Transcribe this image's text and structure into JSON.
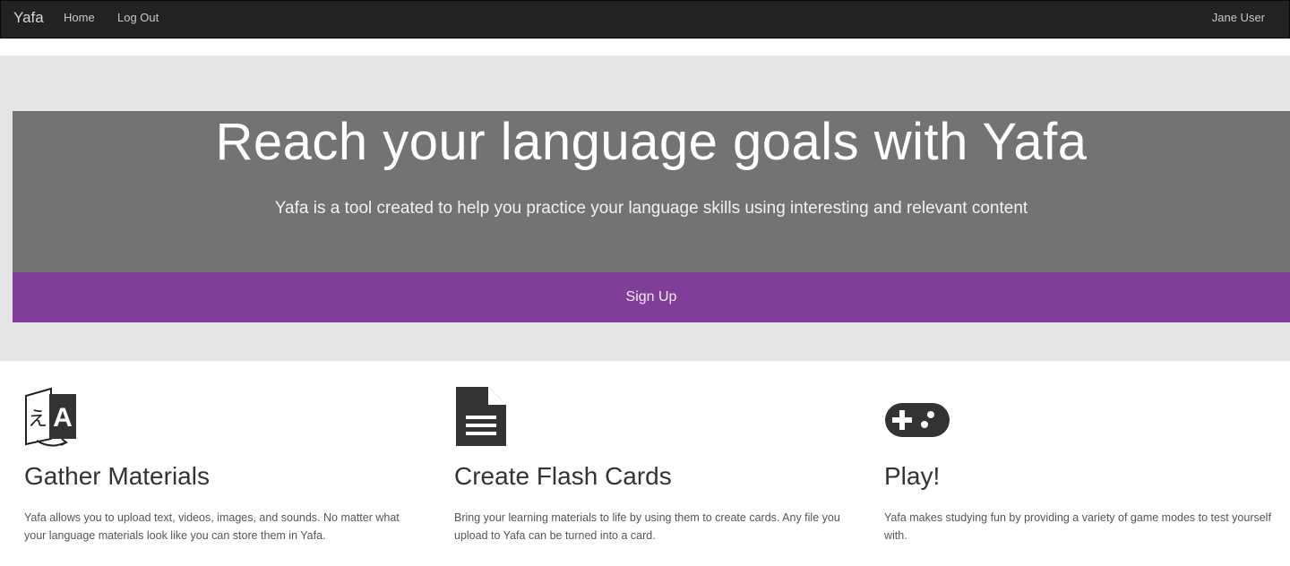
{
  "navbar": {
    "brand": "Yafa",
    "links": [
      {
        "label": "Home"
      },
      {
        "label": "Log Out"
      }
    ],
    "user": "Jane User"
  },
  "hero": {
    "title": "Reach your language goals with Yafa",
    "subtitle": "Yafa is a tool created to help you practice your language skills using interesting and relevant content",
    "cta_label": "Sign Up",
    "cta_color": "#7f3f98"
  },
  "features": [
    {
      "icon": "translate-icon",
      "title": "Gather Materials",
      "text": "Yafa allows you to upload text, videos, images, and sounds. No matter what your language materials look like you can store them in Yafa."
    },
    {
      "icon": "document-icon",
      "title": "Create Flash Cards",
      "text": "Bring your learning materials to life by using them to create cards. Any file you upload to Yafa can be turned into a card."
    },
    {
      "icon": "gamepad-icon",
      "title": "Play!",
      "text": "Yafa makes studying fun by providing a variety of game modes to test yourself with."
    }
  ]
}
